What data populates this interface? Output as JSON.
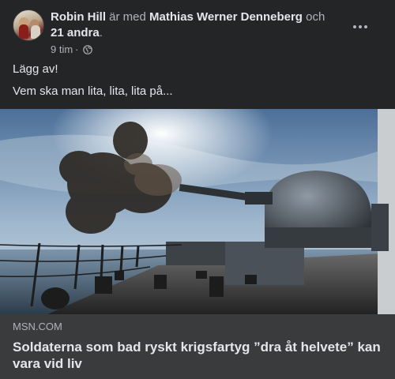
{
  "post": {
    "author": "Robin Hill",
    "with_text": "är med",
    "tagged_person": "Mathias Werner Denneberg",
    "and_text": "och",
    "others": "21 andra",
    "period": ".",
    "timestamp": "9 tim",
    "separator": "·",
    "privacy_icon": "globe-icon",
    "more_icon": "more-options-icon",
    "text_lines": [
      "Lägg av!",
      "Vem ska man lita, lita, lita på..."
    ]
  },
  "link_preview": {
    "domain": "MSN.COM",
    "headline": "Soldaterna som bad ryskt krigsfartyg ”dra åt helvete” kan vara vid liv"
  },
  "colors": {
    "background": "#242526",
    "footer": "#3a3b3c",
    "primary_text": "#e4e6eb",
    "secondary_text": "#b0b3b8"
  }
}
